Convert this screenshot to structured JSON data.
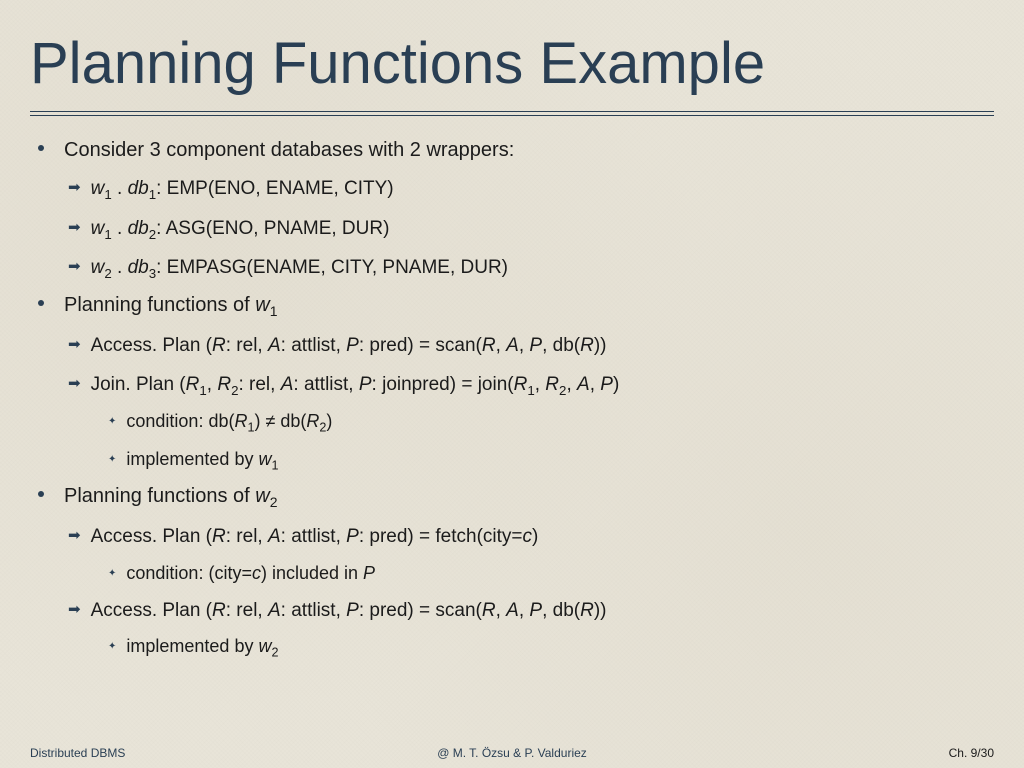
{
  "title": "Planning Functions Example",
  "b1": {
    "text": "Consider 3 component databases with 2 wrappers:",
    "sub1_plain": ": EMP(ENO, ENAME, CITY)",
    "sub2_plain": ": ASG(ENO, PNAME, DUR)",
    "sub3_plain": ": EMPASG(ENAME, CITY, PNAME, DUR)"
  },
  "b2": {
    "text_prefix": "Planning functions of ",
    "sub1_a": "Access. Plan (",
    "sub1_b": ": rel, ",
    "sub1_c": ": attlist, ",
    "sub1_d": ": pred) = scan(",
    "sub1_e": ", db(",
    "sub1_f": "))",
    "sub2_a": "Join. Plan (",
    "sub2_b": ": rel, ",
    "sub2_c": ": attlist, ",
    "sub2_d": ": joinpred) = join(",
    "sub2_e": ")",
    "cond1_a": "condition: db(",
    "cond1_b": ")  ≠ db(",
    "cond1_c": ")",
    "cond2_a": "implemented by "
  },
  "b3": {
    "text_prefix": "Planning functions of ",
    "sub1_a": "Access. Plan (",
    "sub1_b": ": rel, ",
    "sub1_c": ": attlist, ",
    "sub1_d": ": pred) = fetch(city=",
    "sub1_e": ")",
    "cond1_a": "condition: (city=",
    "cond1_b": ") included in  ",
    "sub2_a": "Access. Plan (",
    "sub2_b": ": rel, ",
    "sub2_c": ": attlist, ",
    "sub2_d": ": pred) = scan(",
    "sub2_e": ", db(",
    "sub2_f": "))",
    "cond2_a": "implemented by "
  },
  "vars": {
    "w": "w",
    "db": "db",
    "R": "R",
    "A": "A",
    "P": "P",
    "c": "c",
    "sep": ", "
  },
  "footer": {
    "left": "Distributed DBMS",
    "mid": "@ M. T. Özsu & P. Valduriez",
    "right": "Ch. 9/30"
  }
}
